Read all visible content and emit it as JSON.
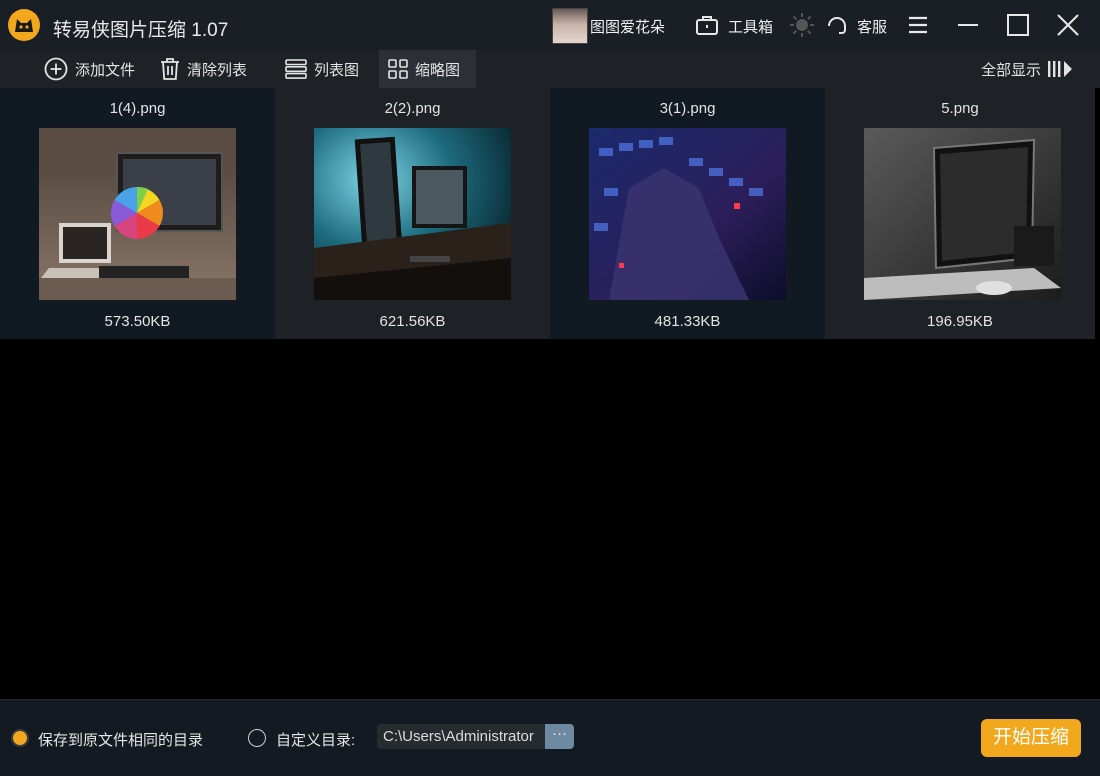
{
  "app": {
    "title": "转易侠图片压缩 1.07"
  },
  "header": {
    "username": "图图爱花朵",
    "toolbox_label": "工具箱",
    "support_label": "客服"
  },
  "toolbar": {
    "add_file": "添加文件",
    "clear_list": "清除列表",
    "list_view": "列表图",
    "thumb_view": "缩略图",
    "show_all": "全部显示"
  },
  "files": [
    {
      "name": "1(4).png",
      "size": "573.50KB"
    },
    {
      "name": "2(2).png",
      "size": "621.56KB"
    },
    {
      "name": "3(1).png",
      "size": "481.33KB"
    },
    {
      "name": "5.png",
      "size": "196.95KB"
    }
  ],
  "footer": {
    "save_same_dir": "保存到原文件相同的目录",
    "custom_dir": "自定义目录:",
    "path_value": "C:\\Users\\Administrator",
    "browse": "···",
    "start": "开始压缩"
  },
  "colors": {
    "accent": "#f2a81d",
    "browse": "#6e8aa3"
  }
}
